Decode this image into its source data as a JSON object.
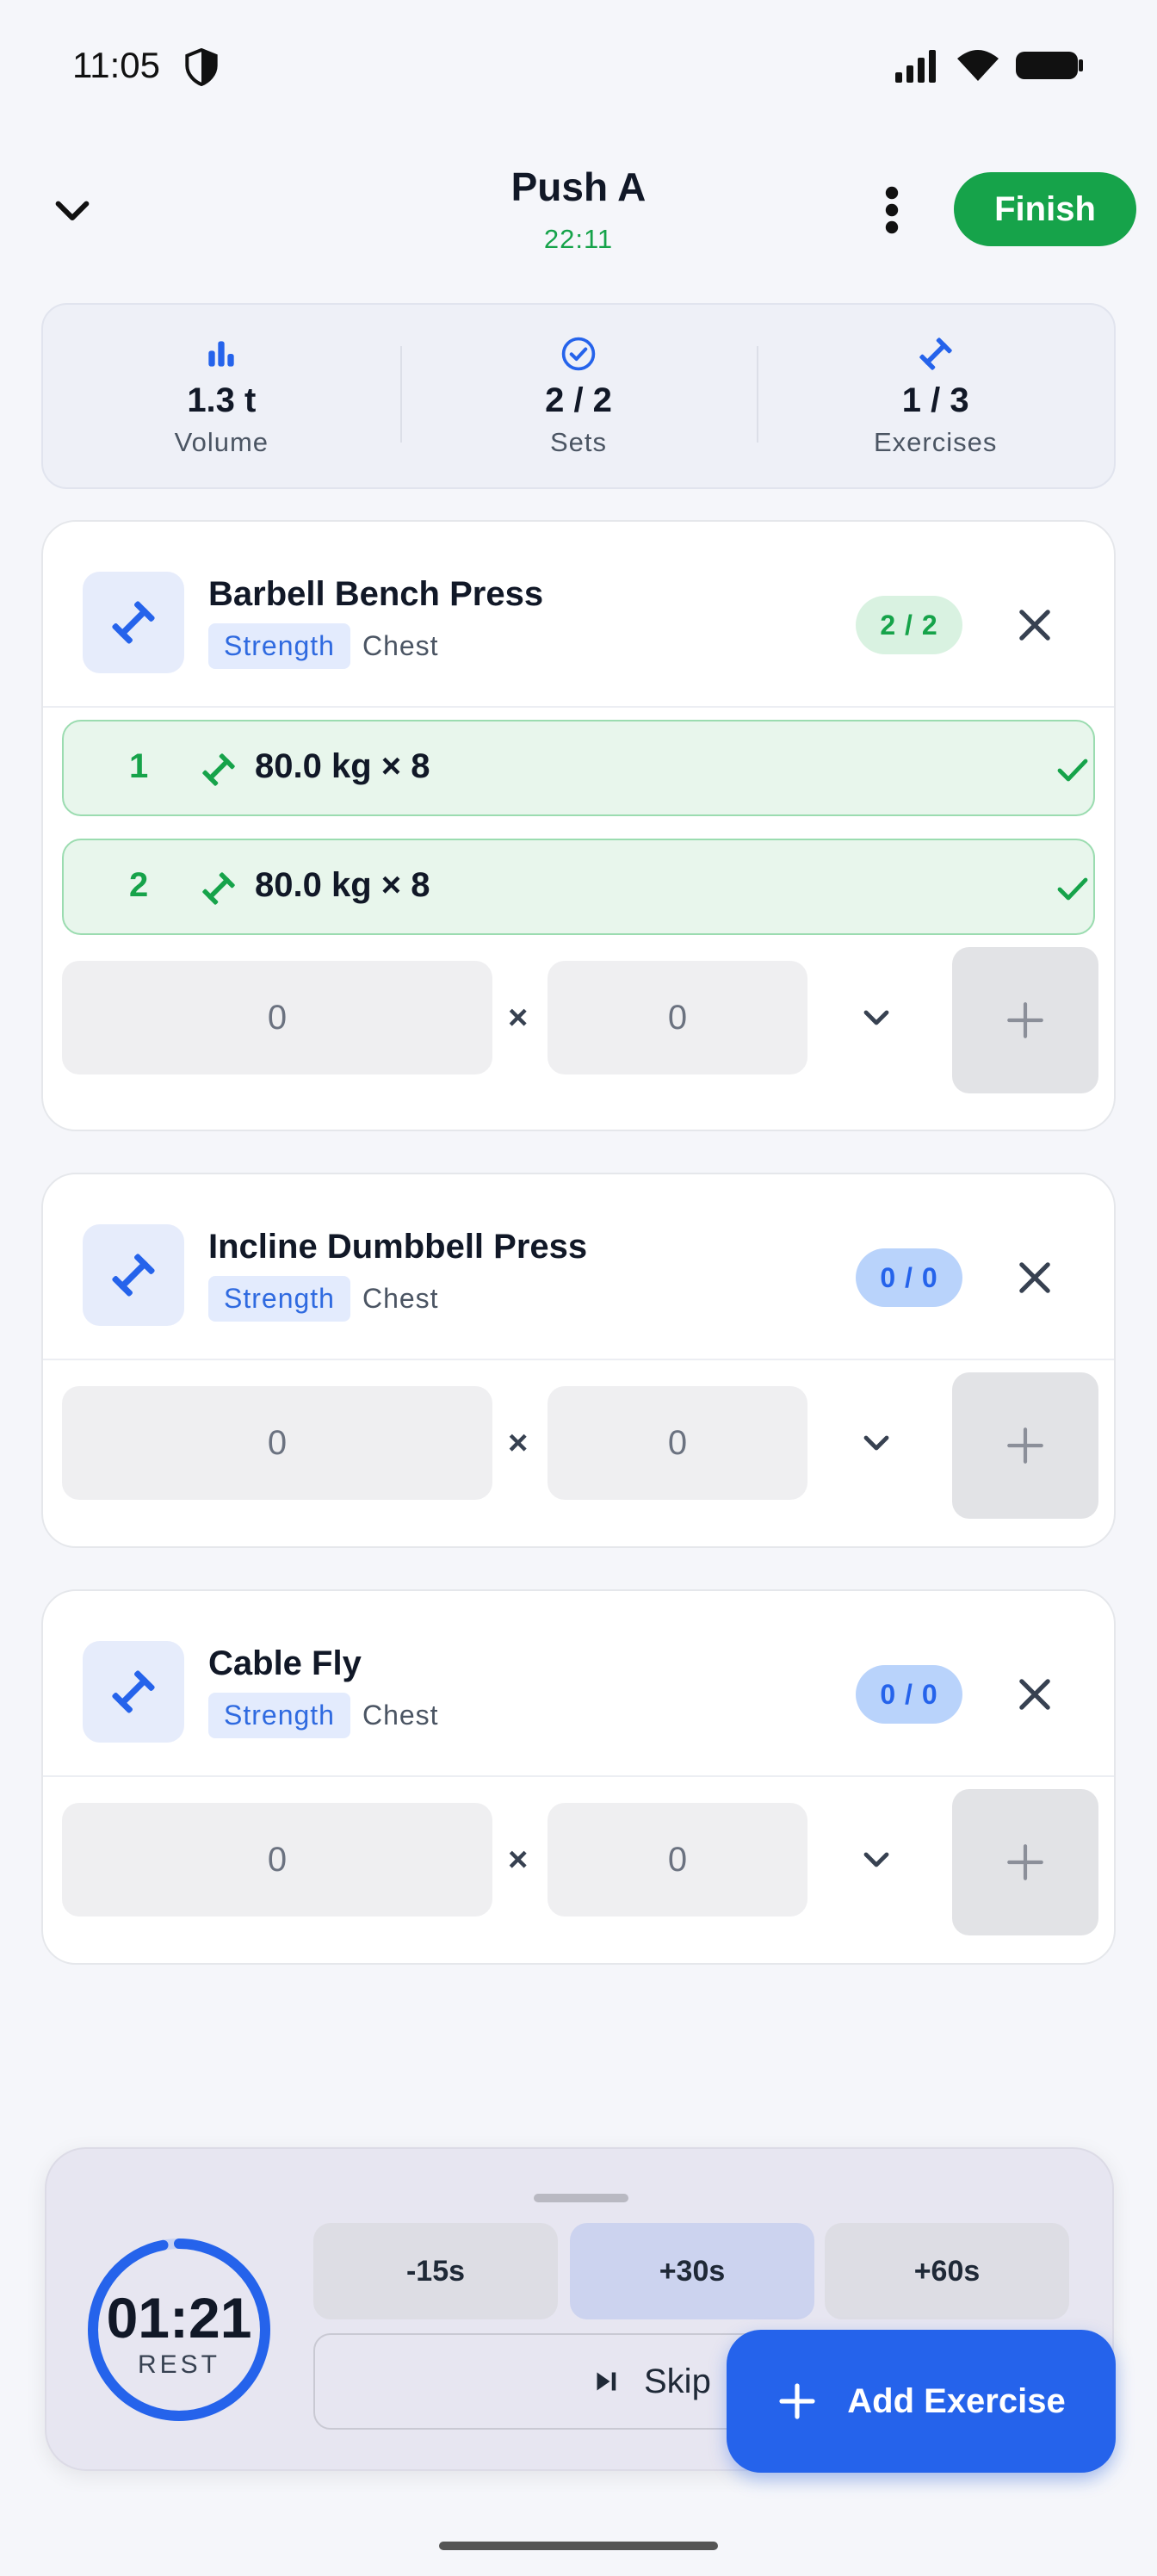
{
  "status": {
    "time": "11:05"
  },
  "header": {
    "title": "Push A",
    "elapsed": "22:11",
    "finish_label": "Finish"
  },
  "stats": [
    {
      "value": "1.3 t",
      "label": "Volume",
      "icon": "bar-chart-icon"
    },
    {
      "value": "2 / 2",
      "label": "Sets",
      "icon": "check-circle-icon"
    },
    {
      "value": "1 / 3",
      "label": "Exercises",
      "icon": "dumbbell-icon"
    }
  ],
  "exercises": [
    {
      "name": "Barbell Bench Press",
      "type": "Strength",
      "muscle": "Chest",
      "count": "2 / 2",
      "sets": [
        {
          "num": "1",
          "text": "80.0 kg × 8"
        },
        {
          "num": "2",
          "text": "80.0 kg × 8"
        }
      ],
      "input": {
        "weight": "0",
        "reps": "0",
        "times": "×"
      }
    },
    {
      "name": "Incline Dumbbell Press",
      "type": "Strength",
      "muscle": "Chest",
      "count": "0 / 0",
      "sets": [],
      "input": {
        "weight": "0",
        "reps": "0",
        "times": "×"
      }
    },
    {
      "name": "Cable Fly",
      "type": "Strength",
      "muscle": "Chest",
      "count": "0 / 0",
      "sets": [],
      "input": {
        "weight": "0",
        "reps": "0",
        "times": "×"
      }
    }
  ],
  "rest": {
    "time": "01:21",
    "label": "REST",
    "progress": 0.97,
    "minus15": "-15s",
    "plus30": "+30s",
    "plus60": "+60s",
    "skip": "Skip"
  },
  "fab": {
    "label": "Add Exercise"
  },
  "colors": {
    "accent": "#2563eb",
    "success": "#16a34a"
  }
}
